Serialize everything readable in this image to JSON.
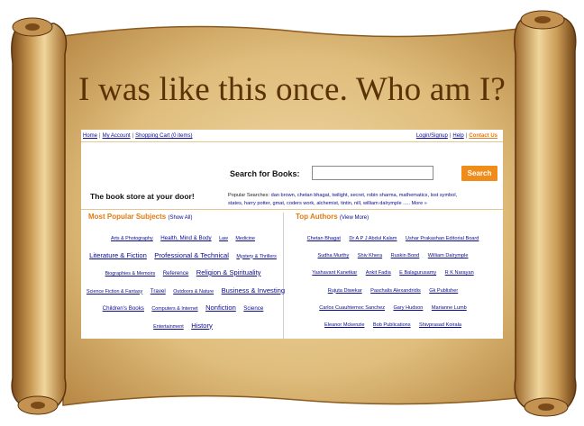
{
  "headline": "I was like this once. Who am I?",
  "colors": {
    "parchment": "#e2c183",
    "scroll_edge": "#8a5a20",
    "accent_orange": "#f08c1a",
    "link_blue": "#0a0a8c",
    "headline_brown": "#5a3206"
  },
  "toplinks": {
    "home": "Home",
    "account": "My Account",
    "cart": "Shopping Cart (0 items)"
  },
  "rightlinks": {
    "login": "Login/Signup",
    "help": "Help",
    "contact": "Contact Us"
  },
  "search": {
    "label": "Search for Books:",
    "button": "Search",
    "value": ""
  },
  "tagline": "The book store at your door!",
  "popular": {
    "label": "Popular Searches:",
    "line1": [
      "dan brown,",
      "chetan bhagat,",
      "twilight,",
      "secret,",
      "robin sharma,",
      "mathematics,",
      "lost symbol,"
    ],
    "line2": [
      "states,",
      "harry potter,",
      "gmat,",
      "coders work,",
      "alchemist,",
      "tintin,",
      "nill,",
      "william dalrymple"
    ],
    "more": "..... More »"
  },
  "subjects": {
    "title": "Most Popular Subjects",
    "show_all": "(Show All)",
    "row1": [
      "Arts & Photography",
      "Health, Mind & Body",
      "Law",
      "Medicine"
    ],
    "row2": [
      "Literature & Fiction",
      "Professional & Technical",
      "Mystery & Thrillers"
    ],
    "row3": [
      "Biographies & Memoirs",
      "Reference",
      "Religion & Spirituality"
    ],
    "row4": [
      "Science Fiction & Fantasy",
      "Travel",
      "Outdoors & Nature",
      "Business & Investing"
    ],
    "row5": [
      "Children's Books",
      "Computers & Internet",
      "Nonfiction",
      "Science"
    ],
    "row6": [
      "Entertainment",
      "History"
    ]
  },
  "authors": {
    "title": "Top Authors",
    "view_more": "(View More)",
    "row1": [
      "Chetan Bhagat",
      "Dr A P J Abdul Kalam",
      "Ushar Prakashan Editorial Board"
    ],
    "row2": [
      "Sudha Murthy",
      "Shiv Khera",
      "Ruskin Bond",
      "William Dalrymple"
    ],
    "row3": [
      "Yashavant Kanetkar",
      "Ankit Fadia",
      "E Balagurusamy",
      "R K Narayan"
    ],
    "row4": [
      "Rujuta Diwekar",
      "Paschalis Alexandridis",
      "Gk Publisher"
    ],
    "row5": [
      "Carlos Cuauhtemoc Sanchez",
      "Gary Hudson",
      "Marianne Lumb"
    ],
    "row6": [
      "Eleanor Mckenzie",
      "Bob Publications",
      "Shivprasad Koirala"
    ]
  }
}
